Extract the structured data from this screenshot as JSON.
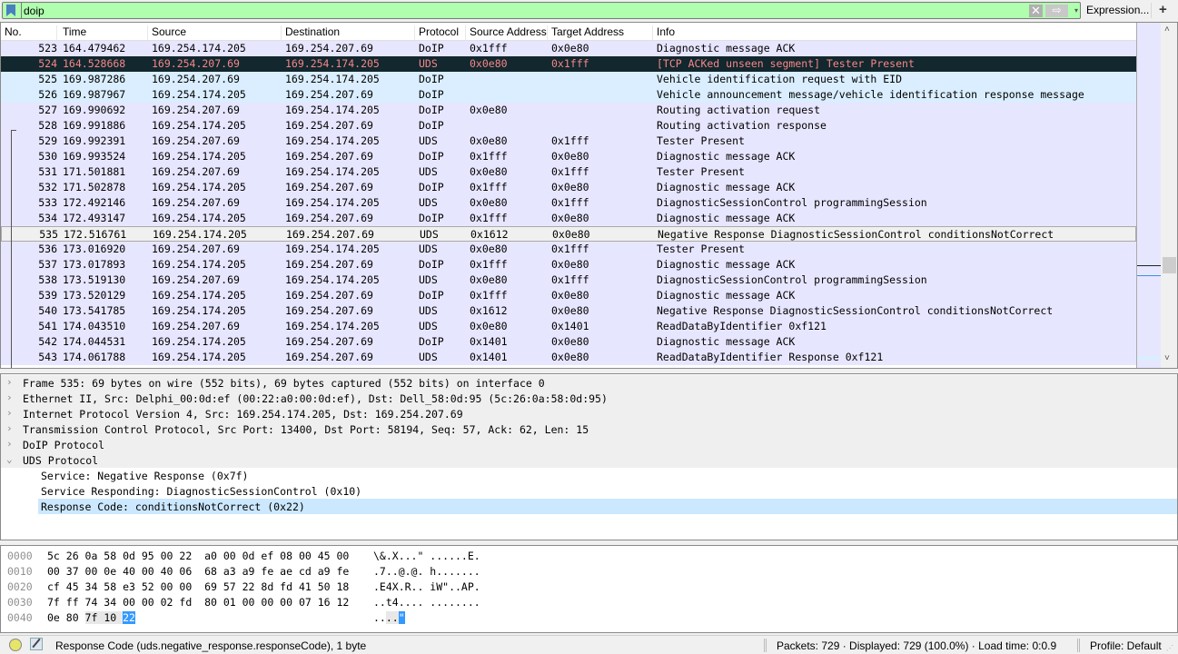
{
  "filter": {
    "value": "doip",
    "clear_icon": "✕",
    "apply_icon": "⇨",
    "history_icon": "▾",
    "expression_label": "Expression...",
    "add_label": "+"
  },
  "packet_list": {
    "columns": [
      "No.",
      "Time",
      "Source",
      "Destination",
      "Protocol",
      "Source Address",
      "Target Address",
      "Info"
    ],
    "rows": [
      {
        "no": "523",
        "time": "164.479462",
        "src": "169.254.174.205",
        "dst": "169.254.207.69",
        "proto": "DoIP",
        "saddr": "0x1fff",
        "taddr": "0x0e80",
        "info": "Diagnostic message ACK",
        "style": "normal"
      },
      {
        "no": "524",
        "time": "164.528668",
        "src": "169.254.207.69",
        "dst": "169.254.174.205",
        "proto": "UDS",
        "saddr": "0x0e80",
        "taddr": "0x1fff",
        "info": "[TCP ACKed unseen segment] Tester Present",
        "style": "bad"
      },
      {
        "no": "525",
        "time": "169.987286",
        "src": "169.254.207.69",
        "dst": "169.254.174.205",
        "proto": "DoIP",
        "saddr": "",
        "taddr": "",
        "info": "Vehicle identification request with EID",
        "style": "doip-light"
      },
      {
        "no": "526",
        "time": "169.987967",
        "src": "169.254.174.205",
        "dst": "169.254.207.69",
        "proto": "DoIP",
        "saddr": "",
        "taddr": "",
        "info": "Vehicle announcement message/vehicle identification response message",
        "style": "doip-light"
      },
      {
        "no": "527",
        "time": "169.990692",
        "src": "169.254.207.69",
        "dst": "169.254.174.205",
        "proto": "DoIP",
        "saddr": "0x0e80",
        "taddr": "",
        "info": "Routing activation request",
        "style": "normal"
      },
      {
        "no": "528",
        "time": "169.991886",
        "src": "169.254.174.205",
        "dst": "169.254.207.69",
        "proto": "DoIP",
        "saddr": "",
        "taddr": "",
        "info": "Routing activation response",
        "style": "normal"
      },
      {
        "no": "529",
        "time": "169.992391",
        "src": "169.254.207.69",
        "dst": "169.254.174.205",
        "proto": "UDS",
        "saddr": "0x0e80",
        "taddr": "0x1fff",
        "info": "Tester Present",
        "style": "normal"
      },
      {
        "no": "530",
        "time": "169.993524",
        "src": "169.254.174.205",
        "dst": "169.254.207.69",
        "proto": "DoIP",
        "saddr": "0x1fff",
        "taddr": "0x0e80",
        "info": "Diagnostic message ACK",
        "style": "normal"
      },
      {
        "no": "531",
        "time": "171.501881",
        "src": "169.254.207.69",
        "dst": "169.254.174.205",
        "proto": "UDS",
        "saddr": "0x0e80",
        "taddr": "0x1fff",
        "info": "Tester Present",
        "style": "normal"
      },
      {
        "no": "532",
        "time": "171.502878",
        "src": "169.254.174.205",
        "dst": "169.254.207.69",
        "proto": "DoIP",
        "saddr": "0x1fff",
        "taddr": "0x0e80",
        "info": "Diagnostic message ACK",
        "style": "normal"
      },
      {
        "no": "533",
        "time": "172.492146",
        "src": "169.254.207.69",
        "dst": "169.254.174.205",
        "proto": "UDS",
        "saddr": "0x0e80",
        "taddr": "0x1fff",
        "info": "DiagnosticSessionControl programmingSession",
        "style": "normal"
      },
      {
        "no": "534",
        "time": "172.493147",
        "src": "169.254.174.205",
        "dst": "169.254.207.69",
        "proto": "DoIP",
        "saddr": "0x1fff",
        "taddr": "0x0e80",
        "info": "Diagnostic message ACK",
        "style": "normal"
      },
      {
        "no": "535",
        "time": "172.516761",
        "src": "169.254.174.205",
        "dst": "169.254.207.69",
        "proto": "UDS",
        "saddr": "0x1612",
        "taddr": "0x0e80",
        "info": "Negative Response DiagnosticSessionControl conditionsNotCorrect",
        "style": "selected"
      },
      {
        "no": "536",
        "time": "173.016920",
        "src": "169.254.207.69",
        "dst": "169.254.174.205",
        "proto": "UDS",
        "saddr": "0x0e80",
        "taddr": "0x1fff",
        "info": "Tester Present",
        "style": "normal"
      },
      {
        "no": "537",
        "time": "173.017893",
        "src": "169.254.174.205",
        "dst": "169.254.207.69",
        "proto": "DoIP",
        "saddr": "0x1fff",
        "taddr": "0x0e80",
        "info": "Diagnostic message ACK",
        "style": "normal"
      },
      {
        "no": "538",
        "time": "173.519130",
        "src": "169.254.207.69",
        "dst": "169.254.174.205",
        "proto": "UDS",
        "saddr": "0x0e80",
        "taddr": "0x1fff",
        "info": "DiagnosticSessionControl programmingSession",
        "style": "normal"
      },
      {
        "no": "539",
        "time": "173.520129",
        "src": "169.254.174.205",
        "dst": "169.254.207.69",
        "proto": "DoIP",
        "saddr": "0x1fff",
        "taddr": "0x0e80",
        "info": "Diagnostic message ACK",
        "style": "normal"
      },
      {
        "no": "540",
        "time": "173.541785",
        "src": "169.254.174.205",
        "dst": "169.254.207.69",
        "proto": "UDS",
        "saddr": "0x1612",
        "taddr": "0x0e80",
        "info": "Negative Response DiagnosticSessionControl conditionsNotCorrect",
        "style": "normal"
      },
      {
        "no": "541",
        "time": "174.043510",
        "src": "169.254.207.69",
        "dst": "169.254.174.205",
        "proto": "UDS",
        "saddr": "0x0e80",
        "taddr": "0x1401",
        "info": "ReadDataByIdentifier 0xf121",
        "style": "normal"
      },
      {
        "no": "542",
        "time": "174.044531",
        "src": "169.254.174.205",
        "dst": "169.254.207.69",
        "proto": "DoIP",
        "saddr": "0x1401",
        "taddr": "0x0e80",
        "info": "Diagnostic message ACK",
        "style": "normal"
      },
      {
        "no": "543",
        "time": "174.061788",
        "src": "169.254.174.205",
        "dst": "169.254.207.69",
        "proto": "UDS",
        "saddr": "0x1401",
        "taddr": "0x0e80",
        "info": "ReadDataByIdentifier Response 0xf121",
        "style": "normal"
      }
    ],
    "scroll_up_icon": "˄",
    "scroll_down_icon": "˅"
  },
  "details": {
    "items": [
      {
        "text": "Frame 535: 69 bytes on wire (552 bits), 69 bytes captured (552 bits) on interface 0",
        "expander": "›",
        "level": 0,
        "style": "top"
      },
      {
        "text": "Ethernet II, Src: Delphi_00:0d:ef (00:22:a0:00:0d:ef), Dst: Dell_58:0d:95 (5c:26:0a:58:0d:95)",
        "expander": "›",
        "level": 0,
        "style": "top"
      },
      {
        "text": "Internet Protocol Version 4, Src: 169.254.174.205, Dst: 169.254.207.69",
        "expander": "›",
        "level": 0,
        "style": "top"
      },
      {
        "text": "Transmission Control Protocol, Src Port: 13400, Dst Port: 58194, Seq: 57, Ack: 62, Len: 15",
        "expander": "›",
        "level": 0,
        "style": "top"
      },
      {
        "text": "DoIP Protocol",
        "expander": "›",
        "level": 0,
        "style": "top"
      },
      {
        "text": "UDS Protocol",
        "expander": "⌄",
        "level": 0,
        "style": "top"
      },
      {
        "text": "Service: Negative Response (0x7f)",
        "expander": "",
        "level": 1,
        "style": "child"
      },
      {
        "text": "Service Responding: DiagnosticSessionControl (0x10)",
        "expander": "",
        "level": 1,
        "style": "child"
      },
      {
        "text": "Response Code: conditionsNotCorrect (0x22)",
        "expander": "",
        "level": 1,
        "style": "child sel"
      }
    ]
  },
  "bytes": {
    "rows": [
      {
        "offset": "0000",
        "hex_pre": "5c 26 0a 58 0d 95 00 22  a0 00 0d ef 08 00 45 00",
        "hex_field": "",
        "hex_sel": "",
        "ascii_pre": "\\&.X...\" ......E.",
        "ascii_field": "",
        "ascii_sel": ""
      },
      {
        "offset": "0010",
        "hex_pre": "00 37 00 0e 40 00 40 06  68 a3 a9 fe ae cd a9 fe",
        "hex_field": "",
        "hex_sel": "",
        "ascii_pre": ".7..@.@. h.......",
        "ascii_field": "",
        "ascii_sel": ""
      },
      {
        "offset": "0020",
        "hex_pre": "cf 45 34 58 e3 52 00 00  69 57 22 8d fd 41 50 18",
        "hex_field": "",
        "hex_sel": "",
        "ascii_pre": ".E4X.R.. iW\"..AP.",
        "ascii_field": "",
        "ascii_sel": ""
      },
      {
        "offset": "0030",
        "hex_pre": "7f ff 74 34 00 00 02 fd  80 01 00 00 00 07 16 12",
        "hex_field": "",
        "hex_sel": "",
        "ascii_pre": "..t4.... ........",
        "ascii_field": "",
        "ascii_sel": ""
      },
      {
        "offset": "0040",
        "hex_pre": "0e 80 ",
        "hex_field": "7f 10 ",
        "hex_sel": "22",
        "ascii_pre": "..",
        "ascii_field": "..",
        "ascii_sel": "\""
      }
    ]
  },
  "status": {
    "expert_icon": "expert-info-led",
    "field_text": "Response Code (uds.negative_response.responseCode), 1 byte",
    "packets_text": "Packets: 729 · Displayed: 729 (100.0%) · Load time: 0:0.9",
    "profile_text": "Profile: Default"
  }
}
